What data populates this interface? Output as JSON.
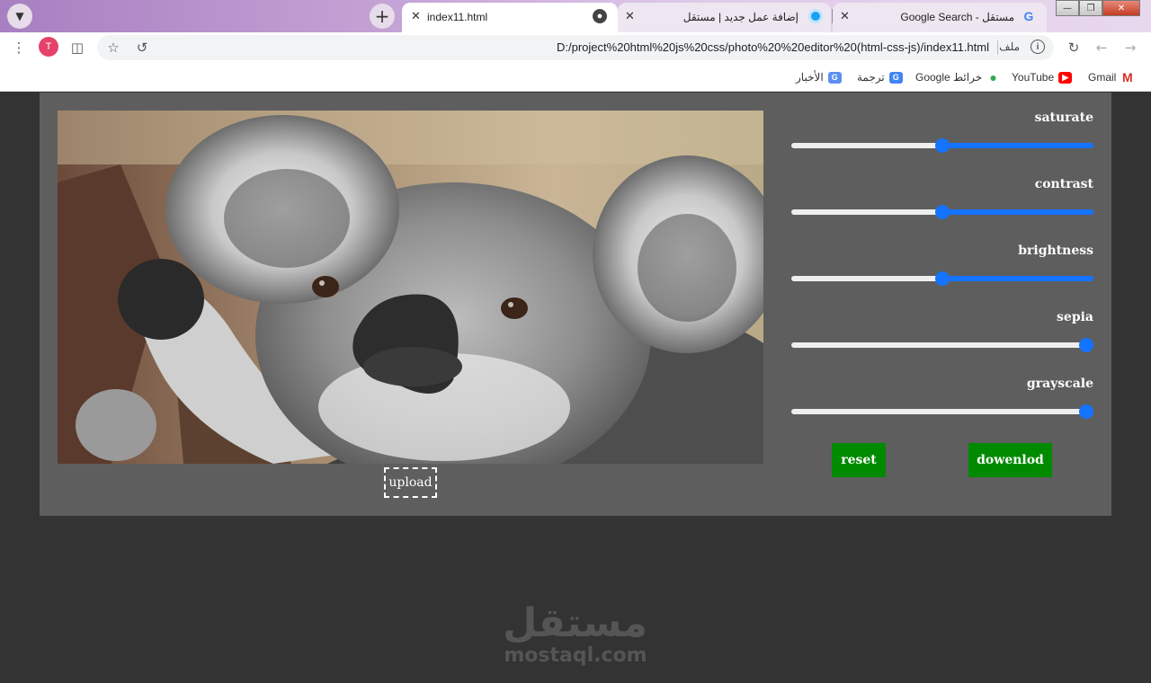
{
  "browser": {
    "tabs": [
      {
        "title": "index11.html",
        "active": true
      },
      {
        "title": "إضافة عمل جديد | مستقل",
        "active": false
      },
      {
        "title": "مستقل - Google Search",
        "active": false
      }
    ],
    "address": "D:/project%20html%20js%20css/photo%20%20editor%20(html-css-js)/index11.html",
    "address_scheme_label": "ملف",
    "profile_initial": "T",
    "bookmarks": [
      {
        "label": "Gmail",
        "icon": "gmail-icon"
      },
      {
        "label": "YouTube",
        "icon": "youtube-icon"
      },
      {
        "label": "خرائط Google",
        "icon": "maps-icon"
      },
      {
        "label": "ترجمة",
        "icon": "translate-icon"
      },
      {
        "label": "الأخبار",
        "icon": "news-icon"
      }
    ]
  },
  "editor": {
    "image_alt": "koala photo",
    "upload_label": "upload",
    "filters": [
      {
        "label": "saturate",
        "value": 50
      },
      {
        "label": "contrast",
        "value": 50
      },
      {
        "label": "brightness",
        "value": 50
      },
      {
        "label": "sepia",
        "value": 100
      },
      {
        "label": "grayscale",
        "value": 100
      }
    ],
    "reset_label": "reset",
    "download_label": "dowenlod"
  },
  "watermark": {
    "arabic": "مستقل",
    "latin": "mostaql.com"
  },
  "colors": {
    "panel": "#5e5e5e",
    "page": "#333333",
    "slider": "#1473ff",
    "button": "#008a00"
  }
}
